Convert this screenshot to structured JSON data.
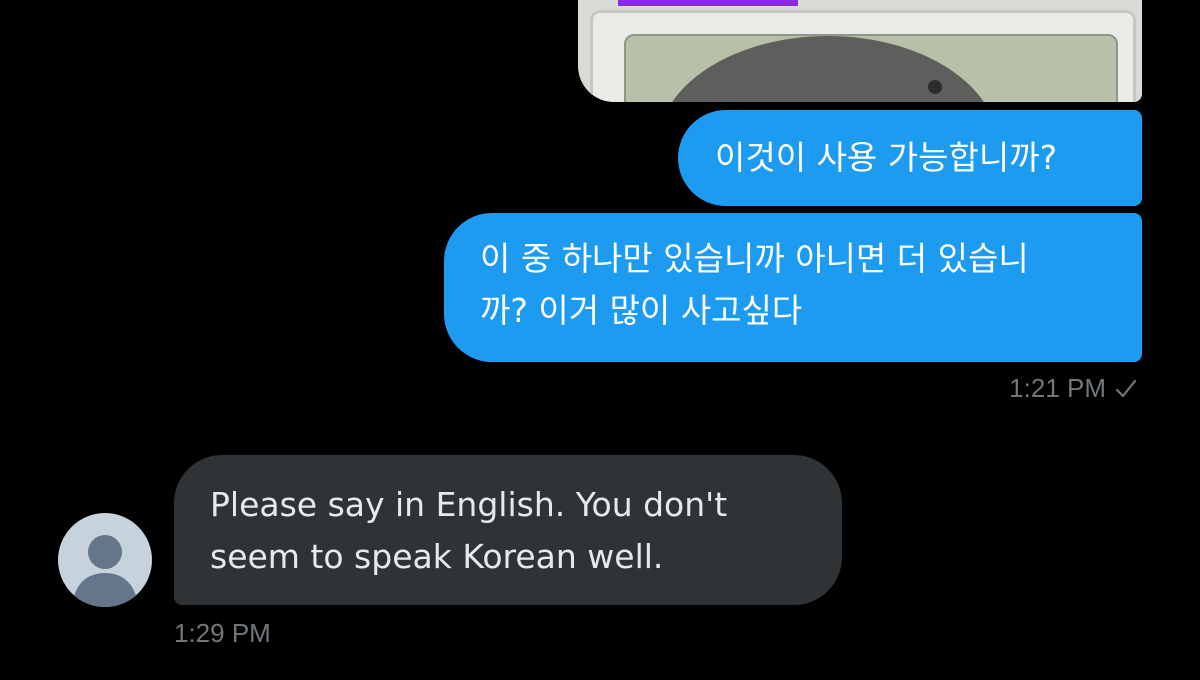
{
  "conversation": {
    "messages": [
      {
        "direction": "sent",
        "text": "이것이 사용 가능합니까?"
      },
      {
        "direction": "sent",
        "text": "이 중 하나만 있습니까 아니면 더 있습니\n까? 이거 많이 사고싶다"
      },
      {
        "direction": "received",
        "text": "Please say in English. You don't\nseem to speak Korean well."
      }
    ],
    "sent_time": "1:21 PM",
    "sent_status_icon": "checkmark-icon",
    "received_time": "1:29 PM",
    "avatar_icon": "default-user-avatar-icon"
  },
  "colors": {
    "background": "#000000",
    "sent_bubble": "#1d9bf0",
    "received_bubble": "#2f3336",
    "timestamp": "#71767b"
  }
}
